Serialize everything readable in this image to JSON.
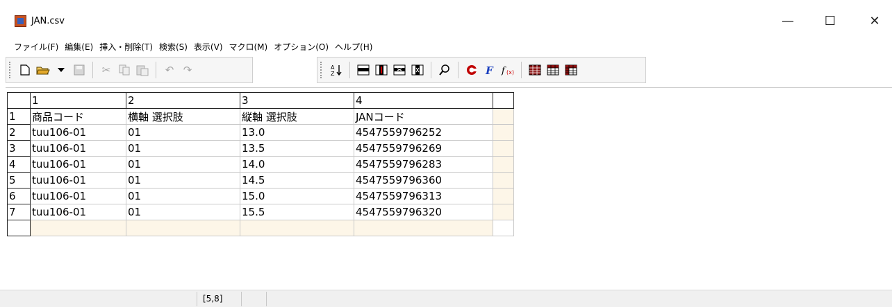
{
  "window": {
    "title": "JAN.csv",
    "minimize": "—",
    "maximize": "☐",
    "close": "✕"
  },
  "menu": [
    {
      "label": "ファイル(F)"
    },
    {
      "label": "編集(E)"
    },
    {
      "label": "挿入・削除(T)"
    },
    {
      "label": "検索(S)"
    },
    {
      "label": "表示(V)"
    },
    {
      "label": "マクロ(M)"
    },
    {
      "label": "オプション(O)"
    },
    {
      "label": "ヘルプ(H)"
    }
  ],
  "toolbar_icons": [
    "new-file-icon",
    "open-folder-icon",
    "dropdown-arrow-icon",
    "save-icon",
    "cut-icon",
    "copy-icon",
    "paste-icon",
    "undo-icon",
    "redo-icon",
    "sort-icon",
    "insert-row-icon",
    "insert-column-icon",
    "delete-row-icon",
    "delete-column-icon",
    "find-icon",
    "color-icon",
    "font-icon",
    "function-icon",
    "grid-style1-icon",
    "grid-style2-icon",
    "grid-style3-icon"
  ],
  "grid": {
    "column_headers": [
      "1",
      "2",
      "3",
      "4"
    ],
    "rows": [
      {
        "num": "1",
        "cells": [
          "商品コード",
          "横軸 選択肢",
          "縦軸 選択肢",
          "JANコード"
        ]
      },
      {
        "num": "2",
        "cells": [
          "tuu106-01",
          "01",
          "13.0",
          "4547559796252"
        ]
      },
      {
        "num": "3",
        "cells": [
          "tuu106-01",
          "01",
          "13.5",
          "4547559796269"
        ]
      },
      {
        "num": "4",
        "cells": [
          "tuu106-01",
          "01",
          "14.0",
          "4547559796283"
        ]
      },
      {
        "num": "5",
        "cells": [
          "tuu106-01",
          "01",
          "14.5",
          "4547559796360"
        ]
      },
      {
        "num": "6",
        "cells": [
          "tuu106-01",
          "01",
          "15.0",
          "4547559796313"
        ]
      },
      {
        "num": "7",
        "cells": [
          "tuu106-01",
          "01",
          "15.5",
          "4547559796320"
        ]
      }
    ]
  },
  "status": {
    "position": "[5,8]"
  }
}
